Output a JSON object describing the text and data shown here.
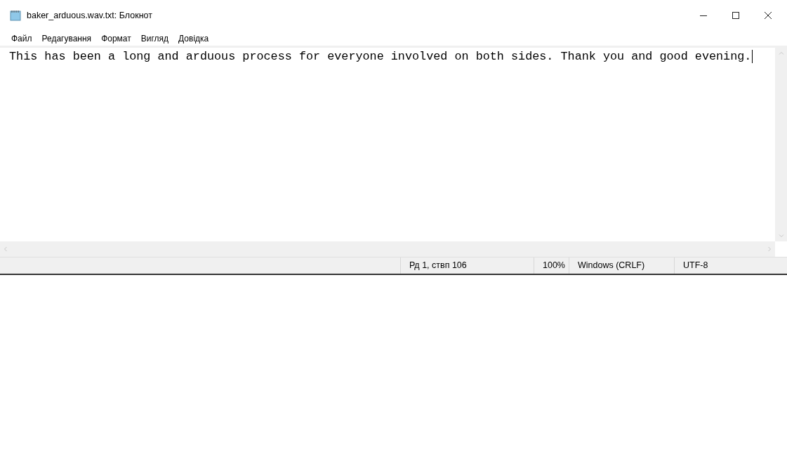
{
  "window": {
    "title": "baker_arduous.wav.txt: Блокнот"
  },
  "menu": [
    "Файл",
    "Редагування",
    "Формат",
    "Вигляд",
    "Довідка"
  ],
  "editor": {
    "text": "This has been a long and arduous process for everyone involved on both sides. Thank you and good evening."
  },
  "status_bar": [
    "Рд 1, ствп 106",
    "100%",
    "Windows (CRLF)",
    "UTF-8"
  ]
}
